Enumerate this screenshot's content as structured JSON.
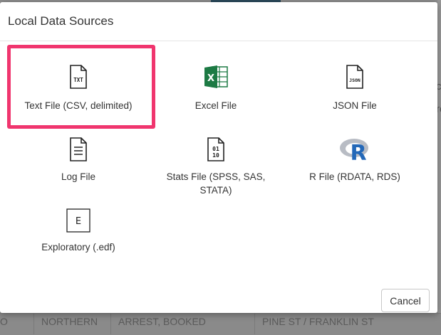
{
  "background": {
    "row_cells": [
      "O",
      "NORTHERN",
      "ARREST, BOOKED",
      "PINE ST / FRANKLIN ST"
    ],
    "peek_letters": [
      "c",
      "ro"
    ]
  },
  "modal": {
    "title": "Local Data Sources",
    "cancel_label": "Cancel"
  },
  "sources": [
    {
      "label": "Text File (CSV, delimited)",
      "icon": "txt-file-icon",
      "icon_text": "TXT"
    },
    {
      "label": "Excel File",
      "icon": "excel-file-icon",
      "icon_text": "X"
    },
    {
      "label": "JSON File",
      "icon": "json-file-icon",
      "icon_text": "JSON"
    },
    {
      "label": "Log File",
      "icon": "log-file-icon"
    },
    {
      "label": "Stats File (SPSS, SAS, STATA)",
      "icon": "stats-file-icon",
      "icon_text": "0110"
    },
    {
      "label": "R File (RDATA, RDS)",
      "icon": "r-logo-icon",
      "icon_text": "R"
    },
    {
      "label": "Exploratory (.edf)",
      "icon": "exploratory-file-icon",
      "icon_text": "E"
    }
  ],
  "colors": {
    "highlight": "#f0356e",
    "excel_green": "#1d7a44",
    "r_blue": "#2368b8"
  }
}
